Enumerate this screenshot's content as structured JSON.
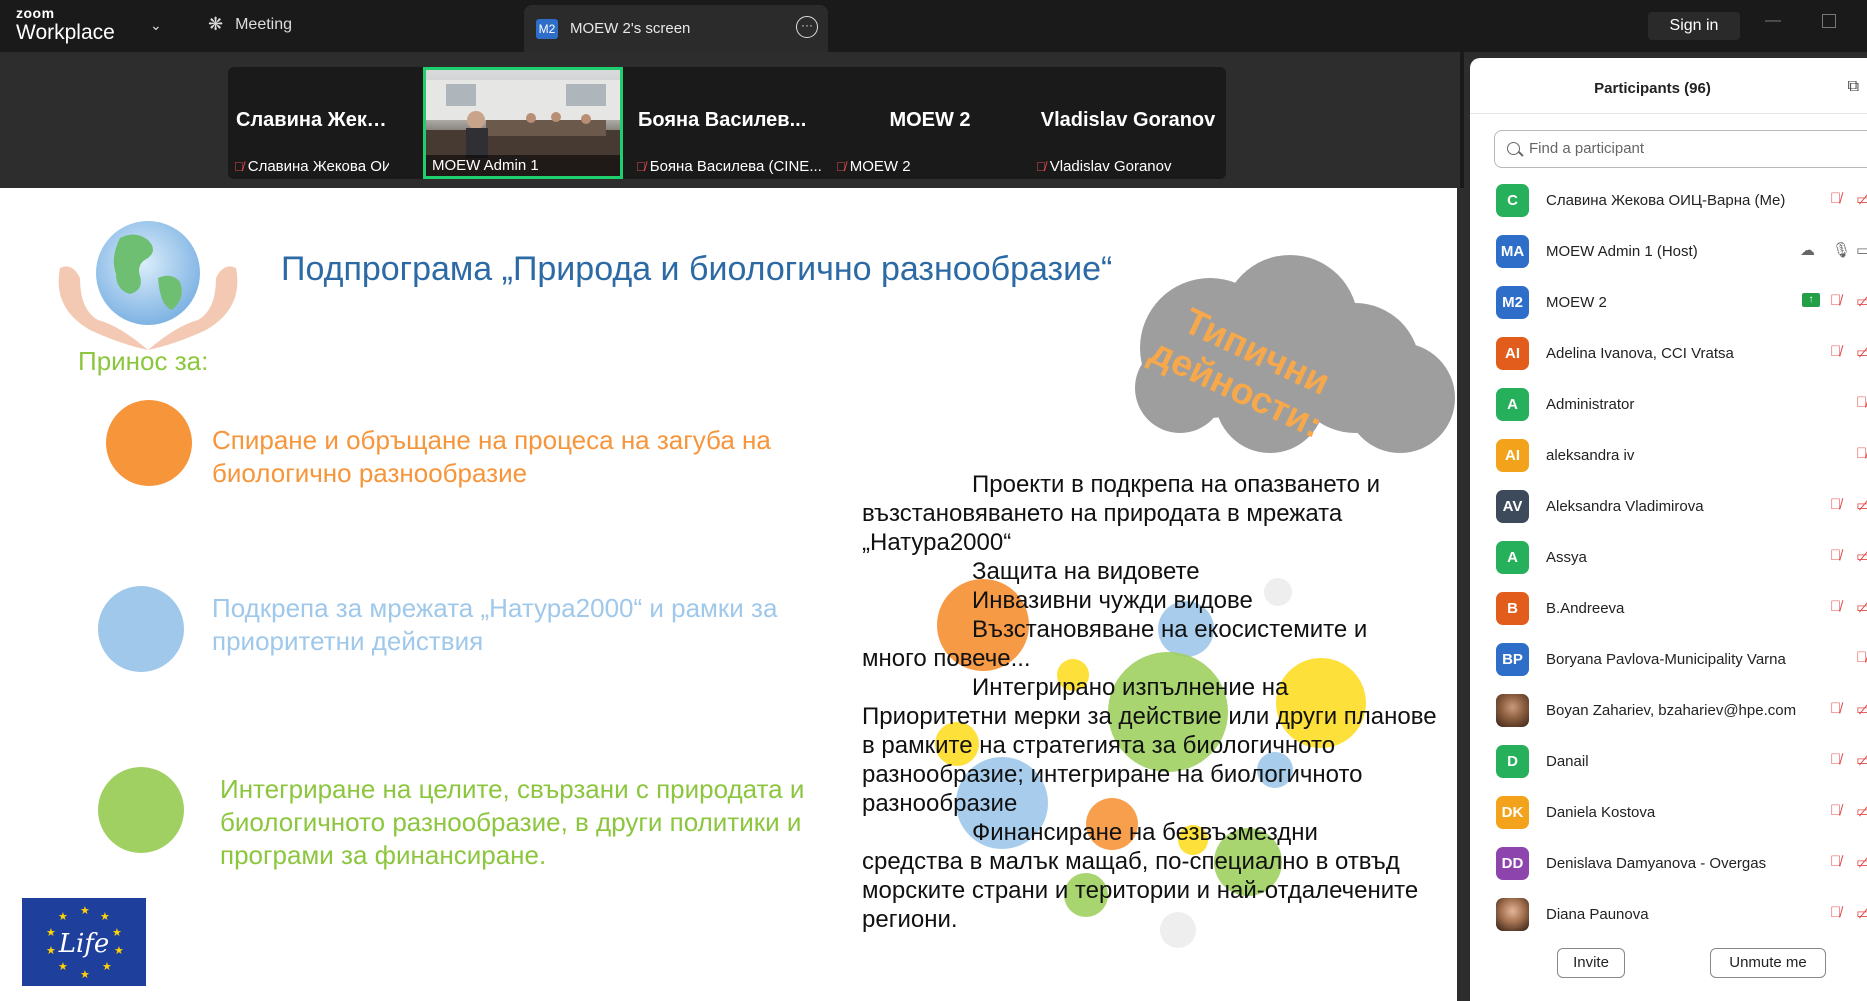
{
  "app": {
    "logo_line1": "zoom",
    "logo_line2": "Workplace",
    "meeting_tab": "Meeting",
    "screen_tab_badge": "M2",
    "screen_tab_label": "MOEW 2's screen",
    "sign_in": "Sign in"
  },
  "filmstrip": [
    {
      "name": "Славина Жеко...",
      "caption": "Славина Жекова ОИЦ...",
      "muted": true
    },
    {
      "name": "",
      "caption": "MOEW Admin 1",
      "muted": false,
      "video": true
    },
    {
      "name": "Бояна Василев...",
      "caption": "Бояна Василева (CINE...",
      "muted": true
    },
    {
      "name": "MOEW 2",
      "caption": "MOEW 2",
      "muted": true
    },
    {
      "name": "Vladislav Goranov",
      "caption": "Vladislav Goranov",
      "muted": true
    }
  ],
  "slide": {
    "title": "Подпрограма „Природа и биологично разнообразие“",
    "subtitle": "Принос за:",
    "bullets": [
      {
        "text": "Спиране и обръщане на процеса на загуба на биологично разнообразие",
        "color": "#f7953b"
      },
      {
        "text": "Подкрепа за мрежата „Натура2000“ и рамки за приоритетни действия",
        "color": "#9fc8ea"
      },
      {
        "text": "Интегриране на целите, свързани с природата и биологичното разнообразие, в други политики и програми за финансиране.",
        "color": "#9fd061"
      }
    ],
    "cloud_text_line1": "Типични",
    "cloud_text_line2": "дейности:",
    "activities": [
      {
        "first": "Проекти в подкрепа на опазването и",
        "rest": "възстановяването на природата в мрежата „Натура2000“"
      },
      {
        "first": "Защита на видовете",
        "rest": ""
      },
      {
        "first": "Инвазивни чужди видове",
        "rest": ""
      },
      {
        "first": "Възстановяване на екосистемите и",
        "rest": "много повече..."
      },
      {
        "first": "Интегрирано изпълнение на",
        "rest": "Приоритетни мерки за действие или други планове в рамките на стратегията за биологичното разнообразие; интегриране на биологичното разнообразие"
      },
      {
        "first": "Финансиране на безвъзмездни",
        "rest": "средства в малък мащаб, по-специално в отвъд морските страни и територии и най-отдалечените региони."
      }
    ],
    "life_logo_text": "Life"
  },
  "participants": {
    "title": "Participants (96)",
    "search_placeholder": "Find a participant",
    "list": [
      {
        "initials": "C",
        "name": "Славина Жекова ОИЦ-Варна (Me)",
        "color": "#27b05b"
      },
      {
        "initials": "MA",
        "name": "MOEW Admin 1 (Host)",
        "color": "#2f6ec8"
      },
      {
        "initials": "M2",
        "name": "MOEW 2",
        "color": "#2f6ec8"
      },
      {
        "initials": "AI",
        "name": "Adelina Ivanova, CCI Vratsa",
        "color": "#e25d1b"
      },
      {
        "initials": "A",
        "name": "Administrator",
        "color": "#27b05b"
      },
      {
        "initials": "AI",
        "name": "aleksandra iv",
        "color": "#f2a31b"
      },
      {
        "initials": "AV",
        "name": "Aleksandra Vladimirova",
        "color": "#3d4a5c"
      },
      {
        "initials": "A",
        "name": "Assya",
        "color": "#27b05b"
      },
      {
        "initials": "B",
        "name": "B.Andreeva",
        "color": "#e25d1b"
      },
      {
        "initials": "BP",
        "name": "Boryana Pavlova-Municipality Varna",
        "color": "#2f6ec8"
      },
      {
        "initials": "",
        "name": "Boyan Zahariev, bzahariev@hpe.com",
        "color": "photo"
      },
      {
        "initials": "D",
        "name": "Danail",
        "color": "#27b05b"
      },
      {
        "initials": "DK",
        "name": "Daniela Kostova",
        "color": "#f2a31b"
      },
      {
        "initials": "DD",
        "name": "Denislava Damyanova - Overgas",
        "color": "#8e44ad"
      },
      {
        "initials": "",
        "name": "Diana Paunova",
        "color": "photo"
      }
    ],
    "invite": "Invite",
    "unmute": "Unmute me"
  }
}
